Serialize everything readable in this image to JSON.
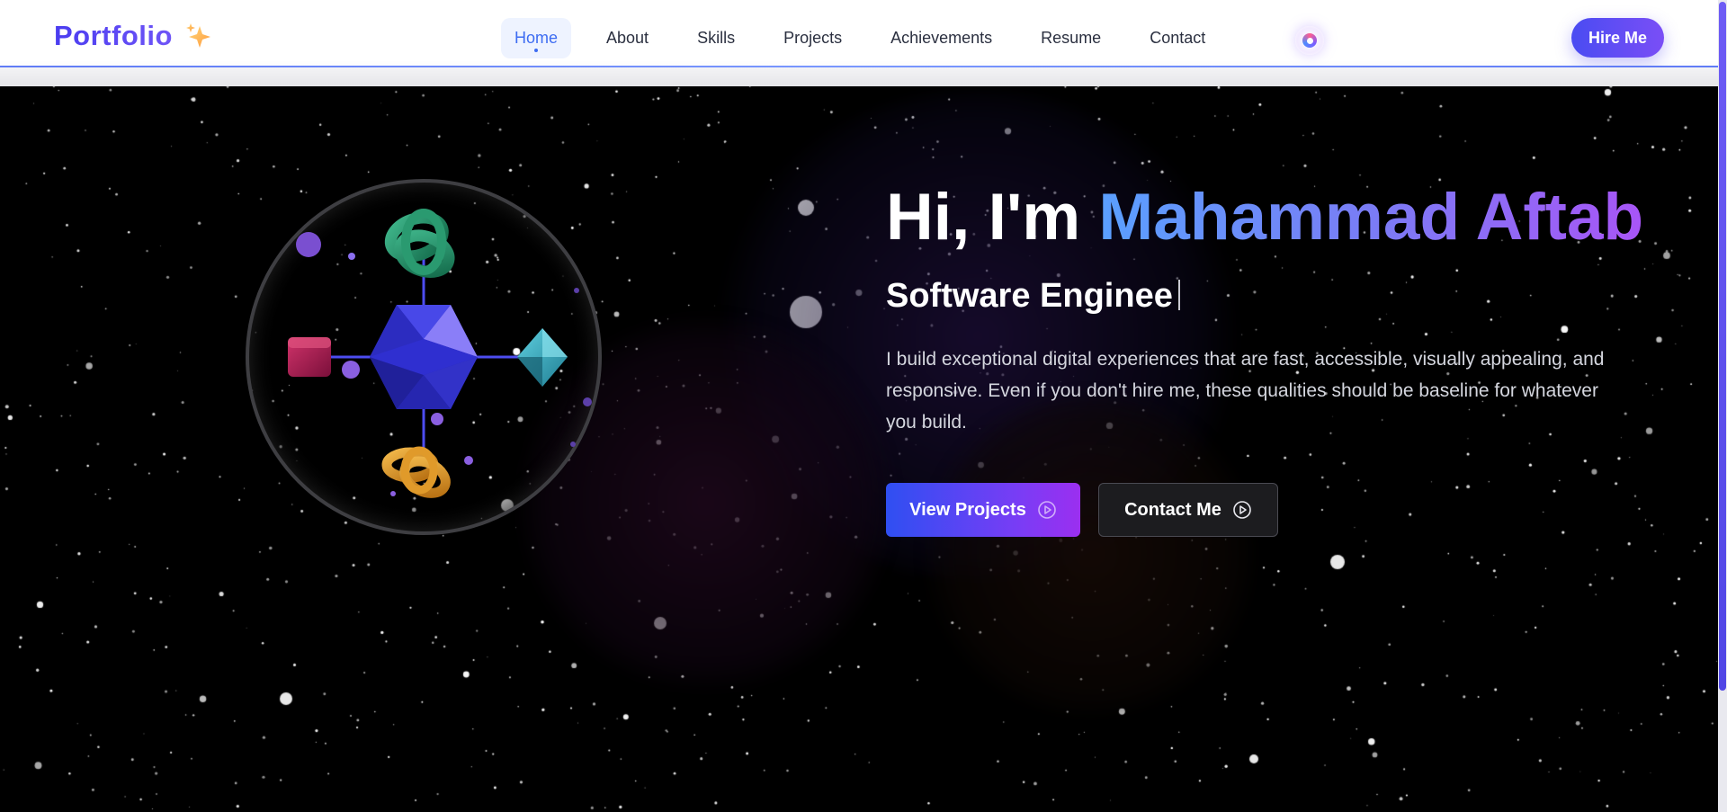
{
  "nav": {
    "brand": "Portfolio",
    "brand_icon": "sparkles-icon",
    "links": [
      "Home",
      "About",
      "Skills",
      "Projects",
      "Achievements",
      "Resume",
      "Contact"
    ],
    "active_link": "Home",
    "theme_toggle_icon": "theme-toggle-icon",
    "hire_button": "Hire Me"
  },
  "hero": {
    "greeting": "Hi, I'm",
    "name": "Mahammad Aftab",
    "role": "Software Enginee",
    "description": "I build exceptional digital experiences that are fast, accessible, visually appealing, and responsive. Even if you don't hire me, these qualities should be baseline for whatever you build.",
    "primary_button": "View Projects",
    "secondary_button": "Contact Me",
    "button_icon": "play-circle-icon"
  },
  "colors": {
    "accent": "#4a4cf2",
    "name_gradient_start": "#5aa0ff",
    "name_gradient_end": "#a855f7",
    "nav_active": "#3d6cf2",
    "hero_background": "#000000"
  }
}
